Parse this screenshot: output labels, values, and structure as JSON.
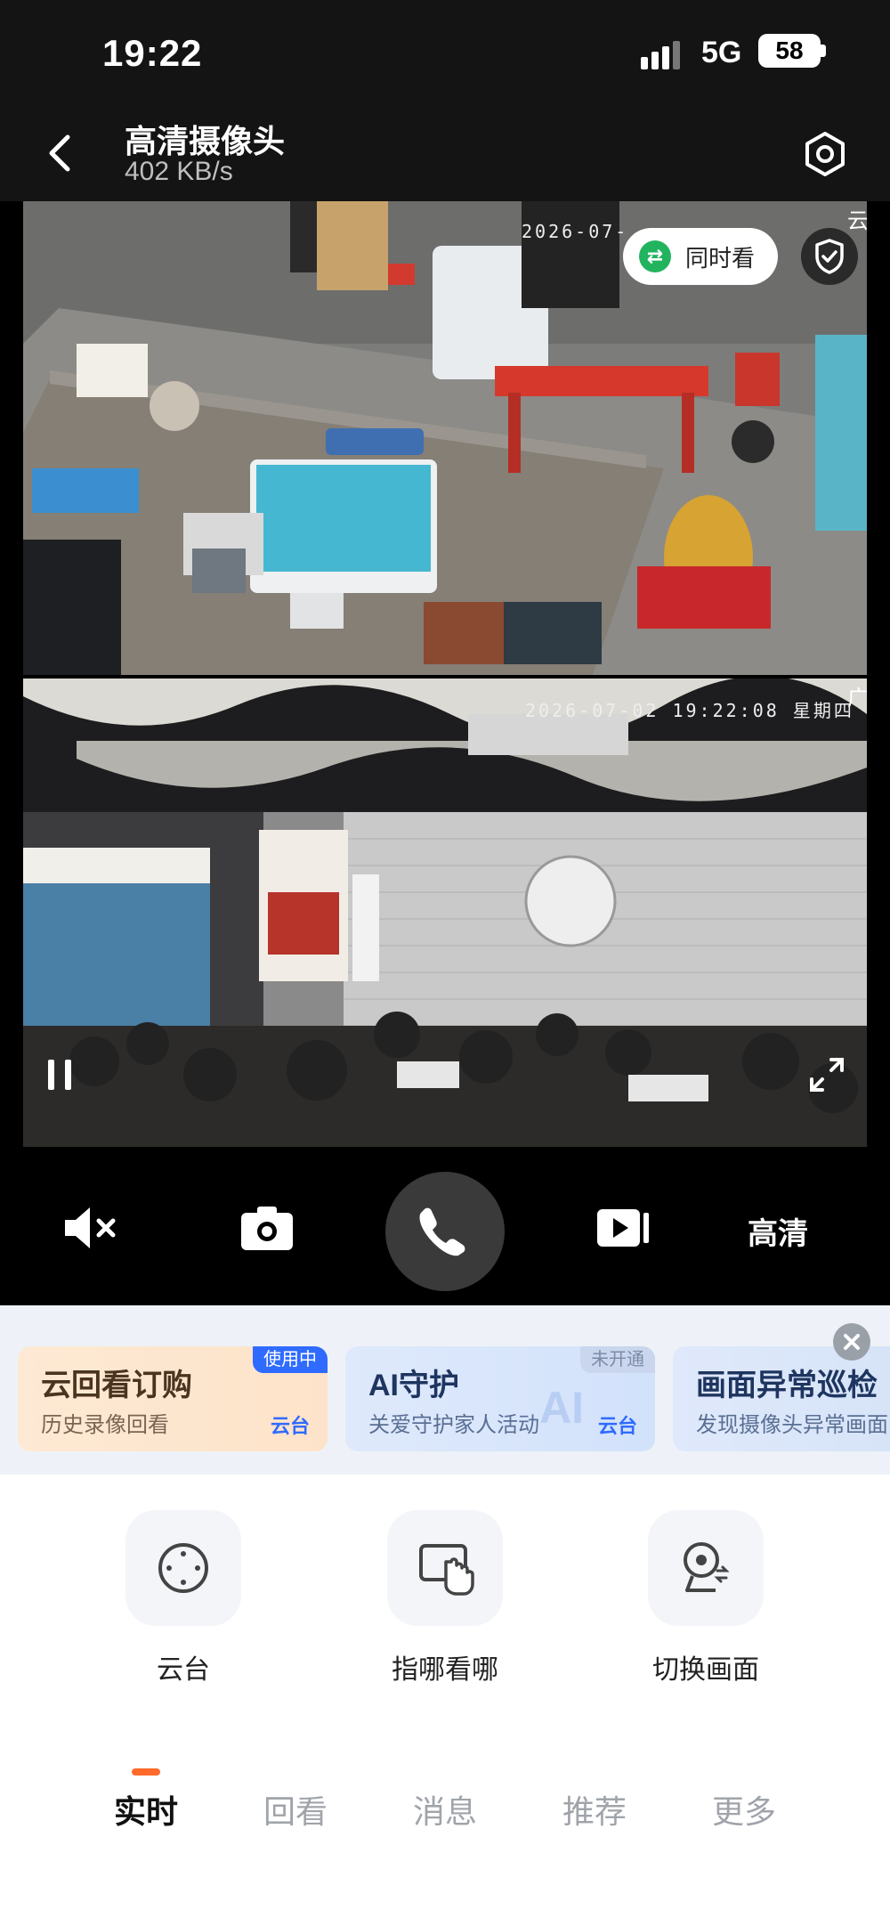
{
  "status_bar": {
    "time": "19:22",
    "network": "5G",
    "battery": "58"
  },
  "header": {
    "title": "高清摄像头",
    "subtitle": "402 KB/s"
  },
  "feed_top": {
    "timestamp": "2026-07-",
    "tag": "云台"
  },
  "feed_bottom": {
    "timestamp": "2026-07-02 19:22:08 星期四",
    "tag": "广角"
  },
  "overlay": {
    "watch_together": "同时看"
  },
  "controls": {
    "quality": "高清"
  },
  "promos": [
    {
      "title": "云回看订购",
      "subtitle": "历史录像回看",
      "badge": "使用中",
      "tag": "云台"
    },
    {
      "title": "AI守护",
      "subtitle": "关爱守护家人活动",
      "badge": "未开通",
      "tag": "云台",
      "mark": "AI"
    },
    {
      "title": "画面异常巡检",
      "subtitle": "发现摄像头异常画面"
    }
  ],
  "features": [
    {
      "label": "云台",
      "icon": "ptz-joystick-icon"
    },
    {
      "label": "指哪看哪",
      "icon": "touch-screen-icon"
    },
    {
      "label": "切换画面",
      "icon": "switch-camera-icon"
    }
  ],
  "tabs": [
    {
      "label": "实时",
      "active": true
    },
    {
      "label": "回看"
    },
    {
      "label": "消息"
    },
    {
      "label": "推荐"
    },
    {
      "label": "更多"
    }
  ],
  "colors": {
    "accent": "#ff6a2b",
    "watch_green": "#22b35e",
    "badge_blue": "#2f6bff"
  }
}
